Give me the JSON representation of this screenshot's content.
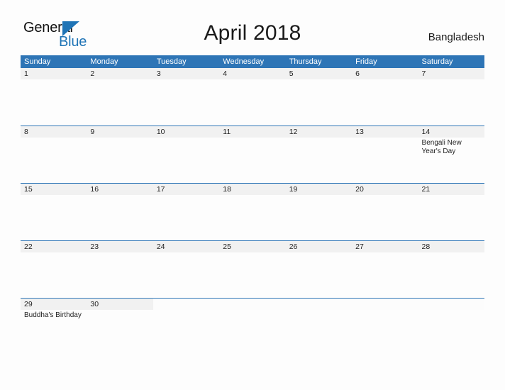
{
  "brand": {
    "name_part1": "General",
    "name_part2": "Blue",
    "triangle_icon": "triangle-icon",
    "colors": {
      "blue": "#1F74B6",
      "black": "#111111"
    }
  },
  "header": {
    "title": "April 2018",
    "country": "Bangladesh"
  },
  "calendar": {
    "colors": {
      "header_blue": "#2E75B6",
      "daynum_band": "#F1F1F1",
      "page_background": "#FDFDFD"
    },
    "weekdays": [
      "Sunday",
      "Monday",
      "Tuesday",
      "Wednesday",
      "Thursday",
      "Friday",
      "Saturday"
    ],
    "weeks": [
      {
        "days": [
          {
            "date": "1",
            "events": []
          },
          {
            "date": "2",
            "events": []
          },
          {
            "date": "3",
            "events": []
          },
          {
            "date": "4",
            "events": []
          },
          {
            "date": "5",
            "events": []
          },
          {
            "date": "6",
            "events": []
          },
          {
            "date": "7",
            "events": []
          }
        ]
      },
      {
        "days": [
          {
            "date": "8",
            "events": []
          },
          {
            "date": "9",
            "events": []
          },
          {
            "date": "10",
            "events": []
          },
          {
            "date": "11",
            "events": []
          },
          {
            "date": "12",
            "events": []
          },
          {
            "date": "13",
            "events": []
          },
          {
            "date": "14",
            "events": [
              "Bengali New Year's Day"
            ]
          }
        ]
      },
      {
        "days": [
          {
            "date": "15",
            "events": []
          },
          {
            "date": "16",
            "events": []
          },
          {
            "date": "17",
            "events": []
          },
          {
            "date": "18",
            "events": []
          },
          {
            "date": "19",
            "events": []
          },
          {
            "date": "20",
            "events": []
          },
          {
            "date": "21",
            "events": []
          }
        ]
      },
      {
        "days": [
          {
            "date": "22",
            "events": []
          },
          {
            "date": "23",
            "events": []
          },
          {
            "date": "24",
            "events": []
          },
          {
            "date": "25",
            "events": []
          },
          {
            "date": "26",
            "events": []
          },
          {
            "date": "27",
            "events": []
          },
          {
            "date": "28",
            "events": []
          }
        ]
      },
      {
        "days": [
          {
            "date": "29",
            "events": [
              "Buddha's Birthday"
            ]
          },
          {
            "date": "30",
            "events": []
          },
          {
            "date": "",
            "events": []
          },
          {
            "date": "",
            "events": []
          },
          {
            "date": "",
            "events": []
          },
          {
            "date": "",
            "events": []
          },
          {
            "date": "",
            "events": []
          }
        ]
      }
    ]
  }
}
